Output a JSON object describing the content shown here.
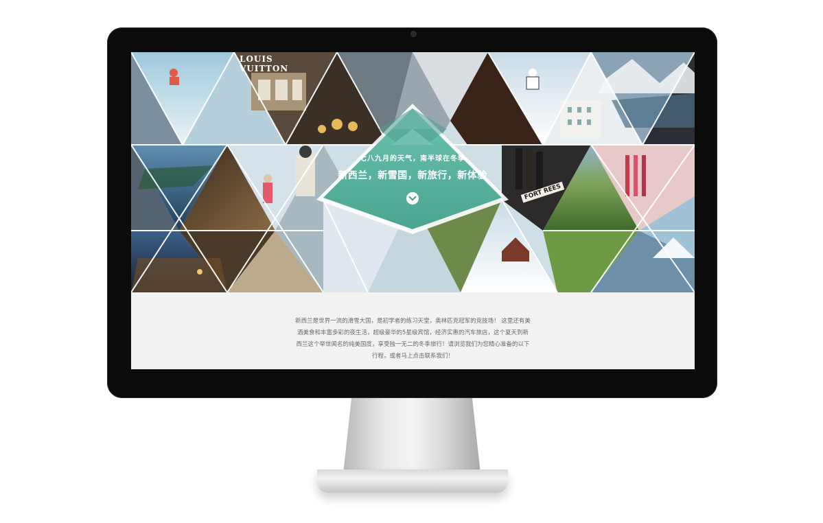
{
  "hero": {
    "subtitle": "七八九月的天气，南半球在冬季",
    "title": "新西兰，新雪国，新旅行，新体验",
    "brand_sign": "LOUIS VUITTON",
    "bottle_label": "FORT REES",
    "scroll_icon": "chevron-down-icon",
    "accent_color": "#5db8a4"
  },
  "intro": {
    "text": "新西兰是世界一流的滑雪大国，是初学者的练习天堂，奥林匹克冠军的竞技场！ 这里还有美酒美食和丰富多彩的夜生活，超级豪华的5星级宾馆，经济实惠的汽车旅店，这个夏天到新西兰这个举世闻名的纯美国度，享受独一无二的冬季旅行！请浏览我们为您精心准备的以下行程，或者马上点击联系我们！"
  }
}
